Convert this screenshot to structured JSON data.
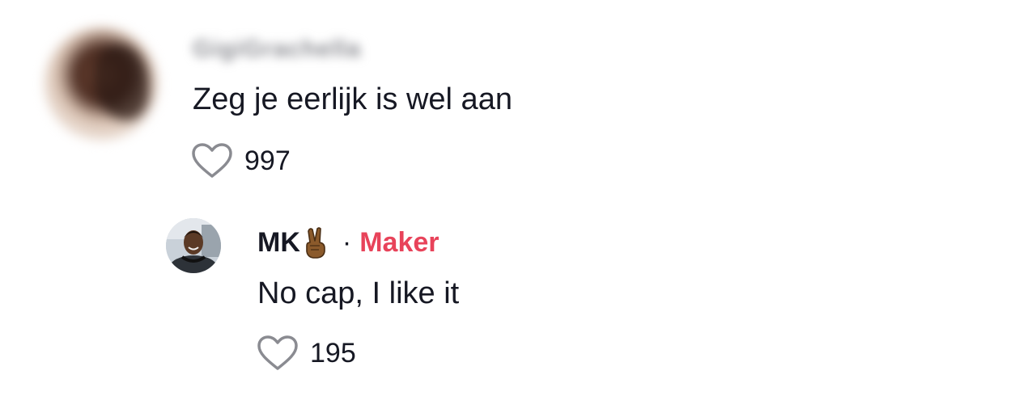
{
  "comment": {
    "username": "GigiGrachella",
    "text": "Zeg je eerlijk is wel aan",
    "likes": "997"
  },
  "reply": {
    "username": "MK",
    "emoji": "victory-hand-icon",
    "separator": "·",
    "badge": "Maker",
    "text": "No cap, I like it",
    "likes": "195"
  },
  "colors": {
    "text": "#161823",
    "badge": "#e8435a",
    "icon": "#8a8b91"
  }
}
